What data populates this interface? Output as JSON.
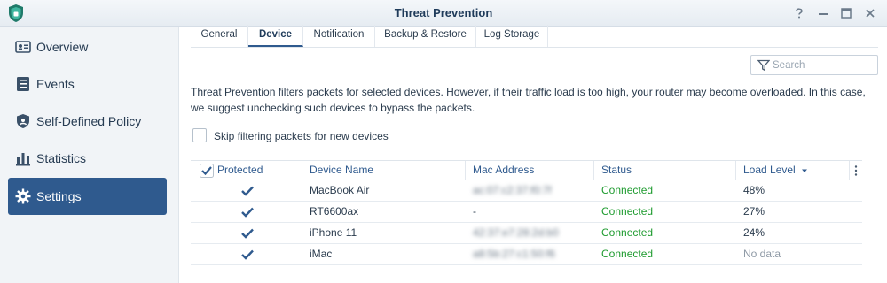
{
  "window": {
    "title": "Threat Prevention"
  },
  "sidebar": {
    "items": [
      {
        "label": "Overview",
        "icon": "overview-icon",
        "active": false
      },
      {
        "label": "Events",
        "icon": "events-icon",
        "active": false
      },
      {
        "label": "Self-Defined Policy",
        "icon": "shield-icon",
        "active": false
      },
      {
        "label": "Statistics",
        "icon": "statistics-icon",
        "active": false
      },
      {
        "label": "Settings",
        "icon": "gear-icon",
        "active": true
      }
    ]
  },
  "tabs": [
    {
      "label": "General",
      "active": false
    },
    {
      "label": "Device",
      "active": true
    },
    {
      "label": "Notification",
      "active": false
    },
    {
      "label": "Backup & Restore",
      "active": false
    },
    {
      "label": "Log Storage",
      "active": false
    }
  ],
  "search": {
    "placeholder": "Search",
    "value": ""
  },
  "description": "Threat Prevention filters packets for selected devices. However, if their traffic load is too high, your router may become overloaded. In this case, we suggest unchecking such devices to bypass the packets.",
  "skip_option": {
    "label": "Skip filtering packets for new devices",
    "checked": false
  },
  "table": {
    "headers": {
      "protected": "Protected",
      "device_name": "Device Name",
      "mac_address": "Mac Address",
      "status": "Status",
      "load_level": "Load Level"
    },
    "header_protected_checked": true,
    "sort_column": "load_level",
    "rows": [
      {
        "protected": true,
        "device_name": "MacBook Air",
        "mac_address": "ac:07:c2:37:f0:7f",
        "mac_blurred": true,
        "status": "Connected",
        "load_level": "48%"
      },
      {
        "protected": true,
        "device_name": "RT6600ax",
        "mac_address": "-",
        "mac_blurred": false,
        "status": "Connected",
        "load_level": "27%"
      },
      {
        "protected": true,
        "device_name": "iPhone 11",
        "mac_address": "42:37:e7:28:2d:b0",
        "mac_blurred": true,
        "status": "Connected",
        "load_level": "24%"
      },
      {
        "protected": true,
        "device_name": "iMac",
        "mac_address": "a8:5b:27:c1:50:f6",
        "mac_blurred": true,
        "status": "Connected",
        "load_level": "No data"
      }
    ]
  },
  "colors": {
    "accent": "#2f5a8e",
    "status_ok": "#1e9b2f",
    "checkbox": "#2f5a8e"
  }
}
